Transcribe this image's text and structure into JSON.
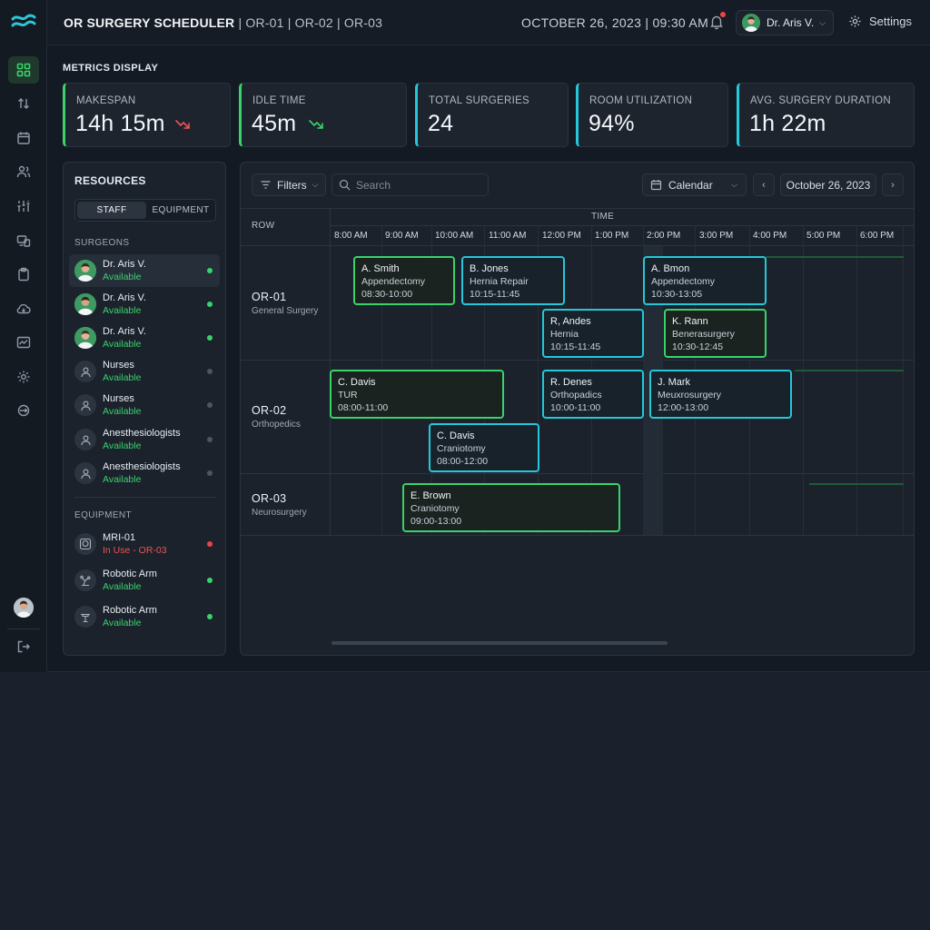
{
  "header": {
    "title": "OR SURGERY SCHEDULER",
    "rooms": "| OR-01 | OR-02 | OR-03",
    "datetime": "OCTOBER 26, 2023 | 09:30 AM",
    "user_name": "Dr. Aris V.",
    "settings_label": "Settings"
  },
  "metrics": {
    "section_label": "METRICS DISPLAY",
    "items": [
      {
        "label": "MAKESPAN",
        "value": "14h 15m",
        "trend": "down"
      },
      {
        "label": "IDLE TIME",
        "value": "45m",
        "trend": "down-good"
      },
      {
        "label": "TOTAL SURGERIES",
        "value": "24"
      },
      {
        "label": "ROOM UTILIZATION",
        "value": "94%"
      },
      {
        "label": "AVG. SURGERY DURATION",
        "value": "1h 22m"
      }
    ]
  },
  "resources": {
    "title": "RESOURCES",
    "tabs": [
      "STAFF",
      "EQUIPMENT"
    ],
    "surgeons_label": "SURGEONS",
    "staff": [
      {
        "name": "Dr. Aris V.",
        "status": "Available"
      },
      {
        "name": "Dr. Aris V.",
        "status": "Available"
      },
      {
        "name": "Dr. Aris V.",
        "status": "Available"
      },
      {
        "name": "Nurses",
        "status": "Available"
      },
      {
        "name": "Nurses",
        "status": "Available"
      },
      {
        "name": "Anesthesiologists",
        "status": "Available"
      },
      {
        "name": "Anesthesiologists",
        "status": "Available"
      }
    ],
    "equipment_label": "EQUIPMENT",
    "equipment": [
      {
        "name": "MRI-01",
        "status": "In Use - OR-03"
      },
      {
        "name": "Robotic Arm",
        "status": "Available"
      },
      {
        "name": "Robotic Arm",
        "status": "Available"
      }
    ]
  },
  "schedule": {
    "filters_label": "Filters",
    "search_placeholder": "Search",
    "view_label": "Calendar",
    "date_label": "October 26, 2023",
    "row_header": "ROW",
    "time_header": "TIME",
    "hours": [
      "8:00 AM",
      "9:00 AM",
      "10:00 AM",
      "11:00 AM",
      "12:00 PM",
      "1:00 PM",
      "2:00 PM",
      "3:00 PM",
      "4:00 PM",
      "5:00 PM",
      "6:00 PM"
    ],
    "rooms": [
      {
        "name": "OR-01",
        "specialty": "General Surgery"
      },
      {
        "name": "OR-02",
        "specialty": "Orthopedics"
      },
      {
        "name": "OR-03",
        "specialty": "Neurosurgery"
      }
    ],
    "blocks": [
      {
        "name": "A. Smith",
        "procedure": "Appendectomy",
        "time": "08:30-10:00"
      },
      {
        "name": "B. Jones",
        "procedure": "Hernia Repair",
        "time": "10:15-11:45"
      },
      {
        "name": "A. Bmon",
        "procedure": "Appendectomy",
        "time": "10:30-13:05"
      },
      {
        "name": "R, Andes",
        "procedure": "Hernia",
        "time": "10:15-11:45"
      },
      {
        "name": "K. Rann",
        "procedure": "Benerasurgery",
        "time": "10:30-12:45"
      },
      {
        "name": "C. Davis",
        "procedure": "TUR",
        "time": "08:00-11:00"
      },
      {
        "name": "R. Denes",
        "procedure": "Orthopadics",
        "time": "10:00-11:00"
      },
      {
        "name": "J. Mark",
        "procedure": "Meuxrosurgery",
        "time": "12:00-13:00"
      },
      {
        "name": "C. Davis",
        "procedure": "Craniotomy",
        "time": "08:00-12:00"
      },
      {
        "name": "E. Brown",
        "procedure": "Craniotomy",
        "time": "09:00-13:00"
      }
    ]
  },
  "colors": {
    "accent_green": "#3ad26b",
    "accent_cyan": "#25c7d9",
    "alert_red": "#ef4444"
  }
}
